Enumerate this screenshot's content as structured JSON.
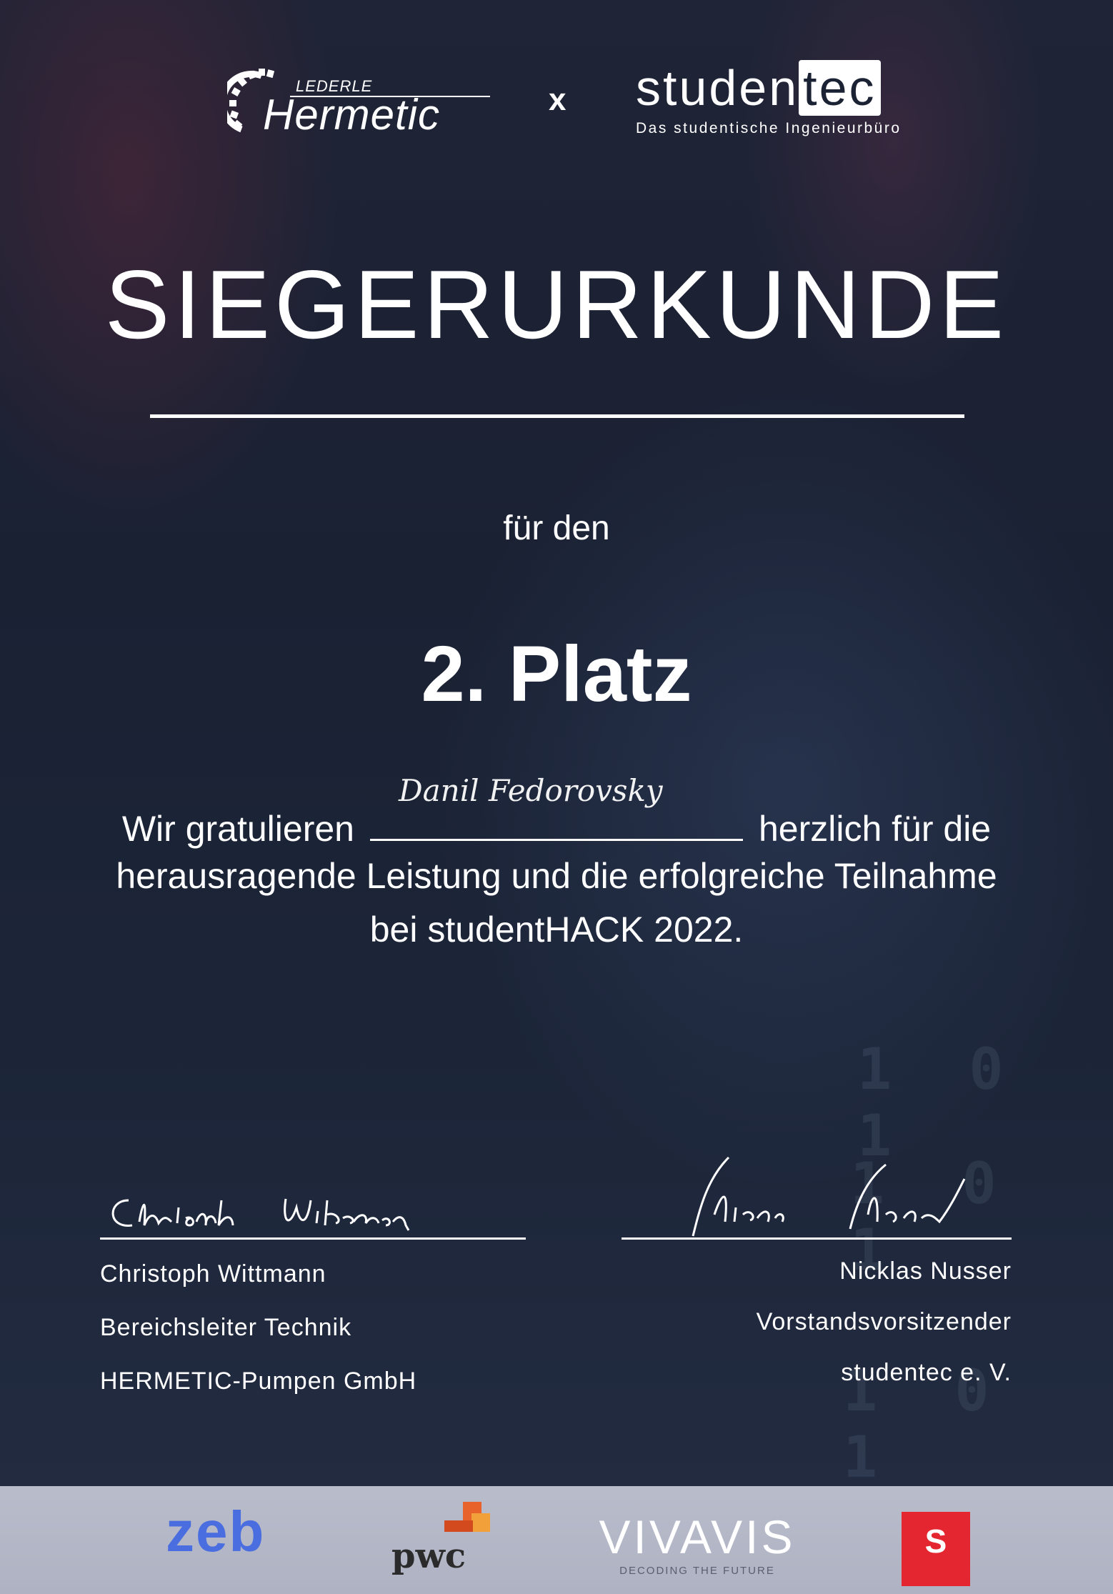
{
  "header": {
    "logo_left": {
      "small": "LEDERLE",
      "name": "Hermetic"
    },
    "separator": "x",
    "logo_right": {
      "name_plain": "studen",
      "name_boxed": "tec",
      "tagline": "Das studentische Ingenieurbüro"
    }
  },
  "certificate": {
    "title": "SIEGERURKUNDE",
    "for_text": "für den",
    "placement": "2. Platz",
    "line1_before": "Wir gratulieren",
    "recipient_handwritten": "Danil Fedorovsky",
    "line1_after": "herzlich für die",
    "line2": "herausragende Leistung und die erfolgreiche Teilnahme",
    "line3": "bei studentHACK 2022."
  },
  "signatories": [
    {
      "signature": "Christoph Wittmann",
      "name": "Christoph Wittmann",
      "role": "Bereichsleiter Technik",
      "org": "HERMETIC-Pumpen GmbH"
    },
    {
      "signature": "Nicklas Nusser",
      "name": "Nicklas Nusser",
      "role": "Vorstandsvorsitzender",
      "org": "studentec e. V."
    }
  ],
  "sponsors": {
    "zeb": "zeb",
    "pwc": "pwc",
    "vivavis": "VIVAVIS",
    "vivavis_tagline": "DECODING THE FUTURE",
    "sparkasse": "S",
    "colors": {
      "zeb": "#4a6ee0",
      "pwc_orange": "#e8632b",
      "pwc_yellow": "#f2a13a",
      "sparkasse": "#e3262f"
    }
  },
  "background_digits": [
    "1 0 1",
    "1 0 1",
    "1 0 1"
  ]
}
